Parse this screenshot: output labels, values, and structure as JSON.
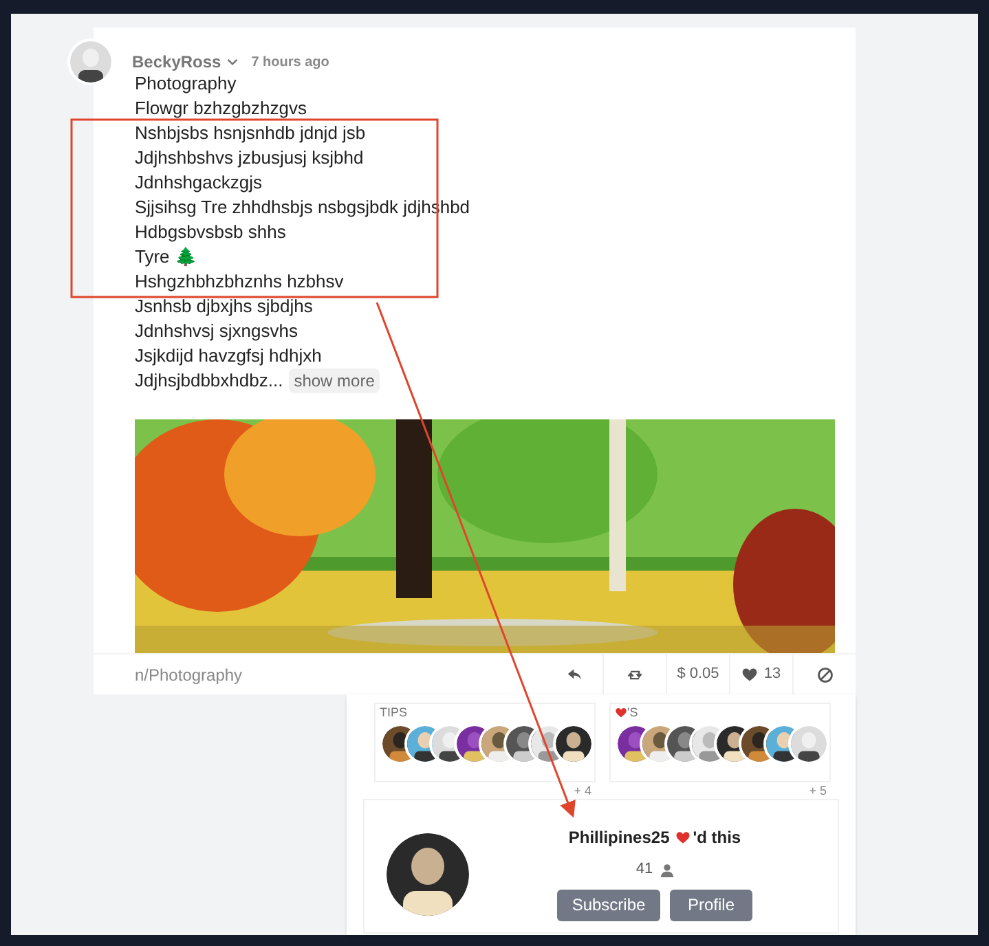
{
  "post": {
    "author": "BeckyRoss",
    "time": "7 hours ago",
    "lines": [
      "Photography",
      "Flowgr bzhzgbzhzgvs",
      "Nshbjsbs hsnjsnhdb jdnjd jsb",
      "Jdjhshbshvs jzbusjusj ksjbhd",
      "Jdnhshgackzgjs",
      "Sjjsihsg Tre zhhdhsbjs nsbgsjbdk jdjhshbd",
      "Hdbgsbvsbsb shhs",
      "Tyre 🌲",
      "Hshgzhbhzbhznhs hzbhsv",
      "Jsnhsb djbxjhs sjbdjhs",
      "Jdnhshvsj sjxngsvhs",
      "Jsjkdijd havzgfsj hdhjxh"
    ],
    "last_line": "Jdjhsjbdbbxhdbz...",
    "show_more": "show more",
    "community": "n/Photography",
    "actions": [
      {
        "kind": "reply"
      },
      {
        "kind": "repost"
      },
      {
        "kind": "tip",
        "label": "$ 0.05"
      },
      {
        "kind": "like",
        "label": "13"
      },
      {
        "kind": "block"
      }
    ]
  },
  "popup": {
    "panels": [
      {
        "kind": "tips",
        "title": "TIPS",
        "more": "+ 4"
      },
      {
        "kind": "hearts",
        "title": "'S",
        "more": "+ 5"
      }
    ],
    "liker": {
      "name": "Phillipines25",
      "suffix": "'d this",
      "count": "41",
      "buttons": [
        "Subscribe",
        "Profile"
      ]
    }
  }
}
